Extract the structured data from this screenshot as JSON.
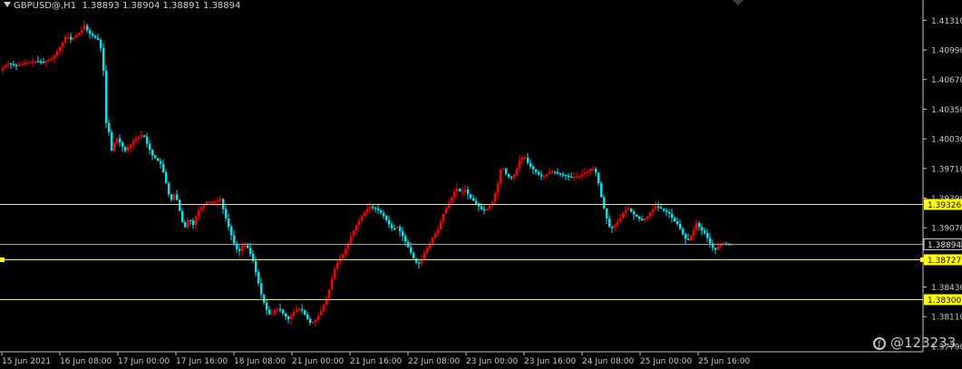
{
  "header": {
    "symbol": "GBPUSD@,H1",
    "ohlc": "1.38893 1.38904 1.38891 1.38894"
  },
  "watermark": "@123233",
  "colors": {
    "background": "#000000",
    "bull": "#ff0000",
    "bear": "#00e5ee",
    "level_line": "#e8e870",
    "price_line": "#9aa0a8",
    "axis": "#c8c8c8"
  },
  "chart_data": {
    "type": "candlestick",
    "instrument": "GBPUSD@",
    "timeframe": "H1",
    "y_ticks": [
      "1.41310",
      "1.40990",
      "1.40670",
      "1.40350",
      "1.40030",
      "1.39710",
      "1.39390",
      "1.39070",
      "1.38750",
      "1.38430",
      "1.38110",
      "1.37790"
    ],
    "ylim": [
      1.3776,
      1.4147
    ],
    "x_ticks": [
      "15 Jun 2021",
      "16 Jun 08:00",
      "17 Jun 00:00",
      "17 Jun 16:00",
      "18 Jun 08:00",
      "21 Jun 00:00",
      "21 Jun 16:00",
      "22 Jun 08:00",
      "23 Jun 00:00",
      "23 Jun 16:00",
      "24 Jun 08:00",
      "25 Jun 00:00",
      "25 Jun 16:00"
    ],
    "horizontal_levels": [
      {
        "value": 1.39326,
        "label": "1.39326",
        "style": "yellow"
      },
      {
        "value": 1.38727,
        "label": "1.38727",
        "style": "yellow"
      },
      {
        "value": 1.383,
        "label": "1.38300",
        "style": "yellow"
      }
    ],
    "current_price": {
      "value": 1.38894,
      "label": "1.38894"
    },
    "price_path": [
      [
        0,
        1.4075
      ],
      [
        10,
        1.4085
      ],
      [
        20,
        1.4082
      ],
      [
        30,
        1.4085
      ],
      [
        40,
        1.4087
      ],
      [
        50,
        1.4086
      ],
      [
        60,
        1.409
      ],
      [
        65,
        1.4098
      ],
      [
        70,
        1.4105
      ],
      [
        75,
        1.4115
      ],
      [
        80,
        1.411
      ],
      [
        90,
        1.4118
      ],
      [
        95,
        1.4125
      ],
      [
        100,
        1.4117
      ],
      [
        110,
        1.411
      ],
      [
        115,
        1.4095
      ],
      [
        118,
        1.404
      ],
      [
        120,
        1.4
      ],
      [
        122,
        1.401
      ],
      [
        125,
        1.399
      ],
      [
        130,
        1.4005
      ],
      [
        140,
        1.399
      ],
      [
        150,
        1.4002
      ],
      [
        160,
        1.4008
      ],
      [
        165,
        1.3995
      ],
      [
        170,
        1.3985
      ],
      [
        180,
        1.3975
      ],
      [
        185,
        1.3955
      ],
      [
        190,
        1.3935
      ],
      [
        195,
        1.3945
      ],
      [
        200,
        1.3925
      ],
      [
        205,
        1.3905
      ],
      [
        210,
        1.3918
      ],
      [
        215,
        1.391
      ],
      [
        220,
        1.3925
      ],
      [
        230,
        1.3935
      ],
      [
        240,
        1.3935
      ],
      [
        245,
        1.3938
      ],
      [
        250,
        1.392
      ],
      [
        255,
        1.3905
      ],
      [
        260,
        1.389
      ],
      [
        265,
        1.388
      ],
      [
        270,
        1.389
      ],
      [
        275,
        1.3885
      ],
      [
        280,
        1.3875
      ],
      [
        285,
        1.3855
      ],
      [
        290,
        1.3835
      ],
      [
        295,
        1.382
      ],
      [
        300,
        1.3812
      ],
      [
        305,
        1.3818
      ],
      [
        310,
        1.382
      ],
      [
        315,
        1.3813
      ],
      [
        320,
        1.3808
      ],
      [
        325,
        1.3815
      ],
      [
        330,
        1.382
      ],
      [
        335,
        1.3818
      ],
      [
        340,
        1.381
      ],
      [
        345,
        1.3803
      ],
      [
        350,
        1.3808
      ],
      [
        355,
        1.3815
      ],
      [
        360,
        1.3825
      ],
      [
        365,
        1.384
      ],
      [
        370,
        1.386
      ],
      [
        375,
        1.3872
      ],
      [
        380,
        1.3878
      ],
      [
        385,
        1.3888
      ],
      [
        390,
        1.39
      ],
      [
        395,
        1.391
      ],
      [
        400,
        1.3918
      ],
      [
        405,
        1.3925
      ],
      [
        410,
        1.393
      ],
      [
        415,
        1.3928
      ],
      [
        420,
        1.3925
      ],
      [
        425,
        1.392
      ],
      [
        430,
        1.3912
      ],
      [
        435,
        1.3905
      ],
      [
        440,
        1.3908
      ],
      [
        445,
        1.39
      ],
      [
        450,
        1.389
      ],
      [
        455,
        1.388
      ],
      [
        460,
        1.387
      ],
      [
        465,
        1.3868
      ],
      [
        470,
        1.388
      ],
      [
        475,
        1.3888
      ],
      [
        480,
        1.3898
      ],
      [
        485,
        1.3905
      ],
      [
        490,
        1.392
      ],
      [
        495,
        1.393
      ],
      [
        500,
        1.394
      ],
      [
        505,
        1.395
      ],
      [
        510,
        1.3945
      ],
      [
        515,
        1.3948
      ],
      [
        520,
        1.394
      ],
      [
        525,
        1.3935
      ],
      [
        530,
        1.393
      ],
      [
        535,
        1.3925
      ],
      [
        540,
        1.3928
      ],
      [
        545,
        1.3935
      ],
      [
        550,
        1.395
      ],
      [
        555,
        1.3975
      ],
      [
        560,
        1.3965
      ],
      [
        565,
        1.396
      ],
      [
        570,
        1.3965
      ],
      [
        575,
        1.398
      ],
      [
        580,
        1.3985
      ],
      [
        585,
        1.3975
      ],
      [
        590,
        1.397
      ],
      [
        595,
        1.3965
      ],
      [
        600,
        1.3962
      ],
      [
        610,
        1.3968
      ],
      [
        620,
        1.3965
      ],
      [
        630,
        1.3962
      ],
      [
        640,
        1.3962
      ],
      [
        650,
        1.3968
      ],
      [
        655,
        1.3972
      ],
      [
        660,
        1.3965
      ],
      [
        665,
        1.394
      ],
      [
        670,
        1.392
      ],
      [
        675,
        1.3905
      ],
      [
        680,
        1.391
      ],
      [
        685,
        1.3915
      ],
      [
        690,
        1.3925
      ],
      [
        695,
        1.3928
      ],
      [
        700,
        1.3922
      ],
      [
        705,
        1.3918
      ],
      [
        710,
        1.3915
      ],
      [
        715,
        1.3918
      ],
      [
        720,
        1.3925
      ],
      [
        725,
        1.393
      ],
      [
        730,
        1.3928
      ],
      [
        735,
        1.3925
      ],
      [
        740,
        1.3922
      ],
      [
        745,
        1.3915
      ],
      [
        750,
        1.391
      ],
      [
        755,
        1.39
      ],
      [
        760,
        1.3892
      ],
      [
        765,
        1.39
      ],
      [
        770,
        1.3912
      ],
      [
        775,
        1.3905
      ],
      [
        780,
        1.39
      ],
      [
        785,
        1.389
      ],
      [
        790,
        1.3882
      ],
      [
        795,
        1.3888
      ],
      [
        800,
        1.389
      ],
      [
        805,
        1.3889
      ],
      [
        810,
        1.38894
      ]
    ]
  }
}
